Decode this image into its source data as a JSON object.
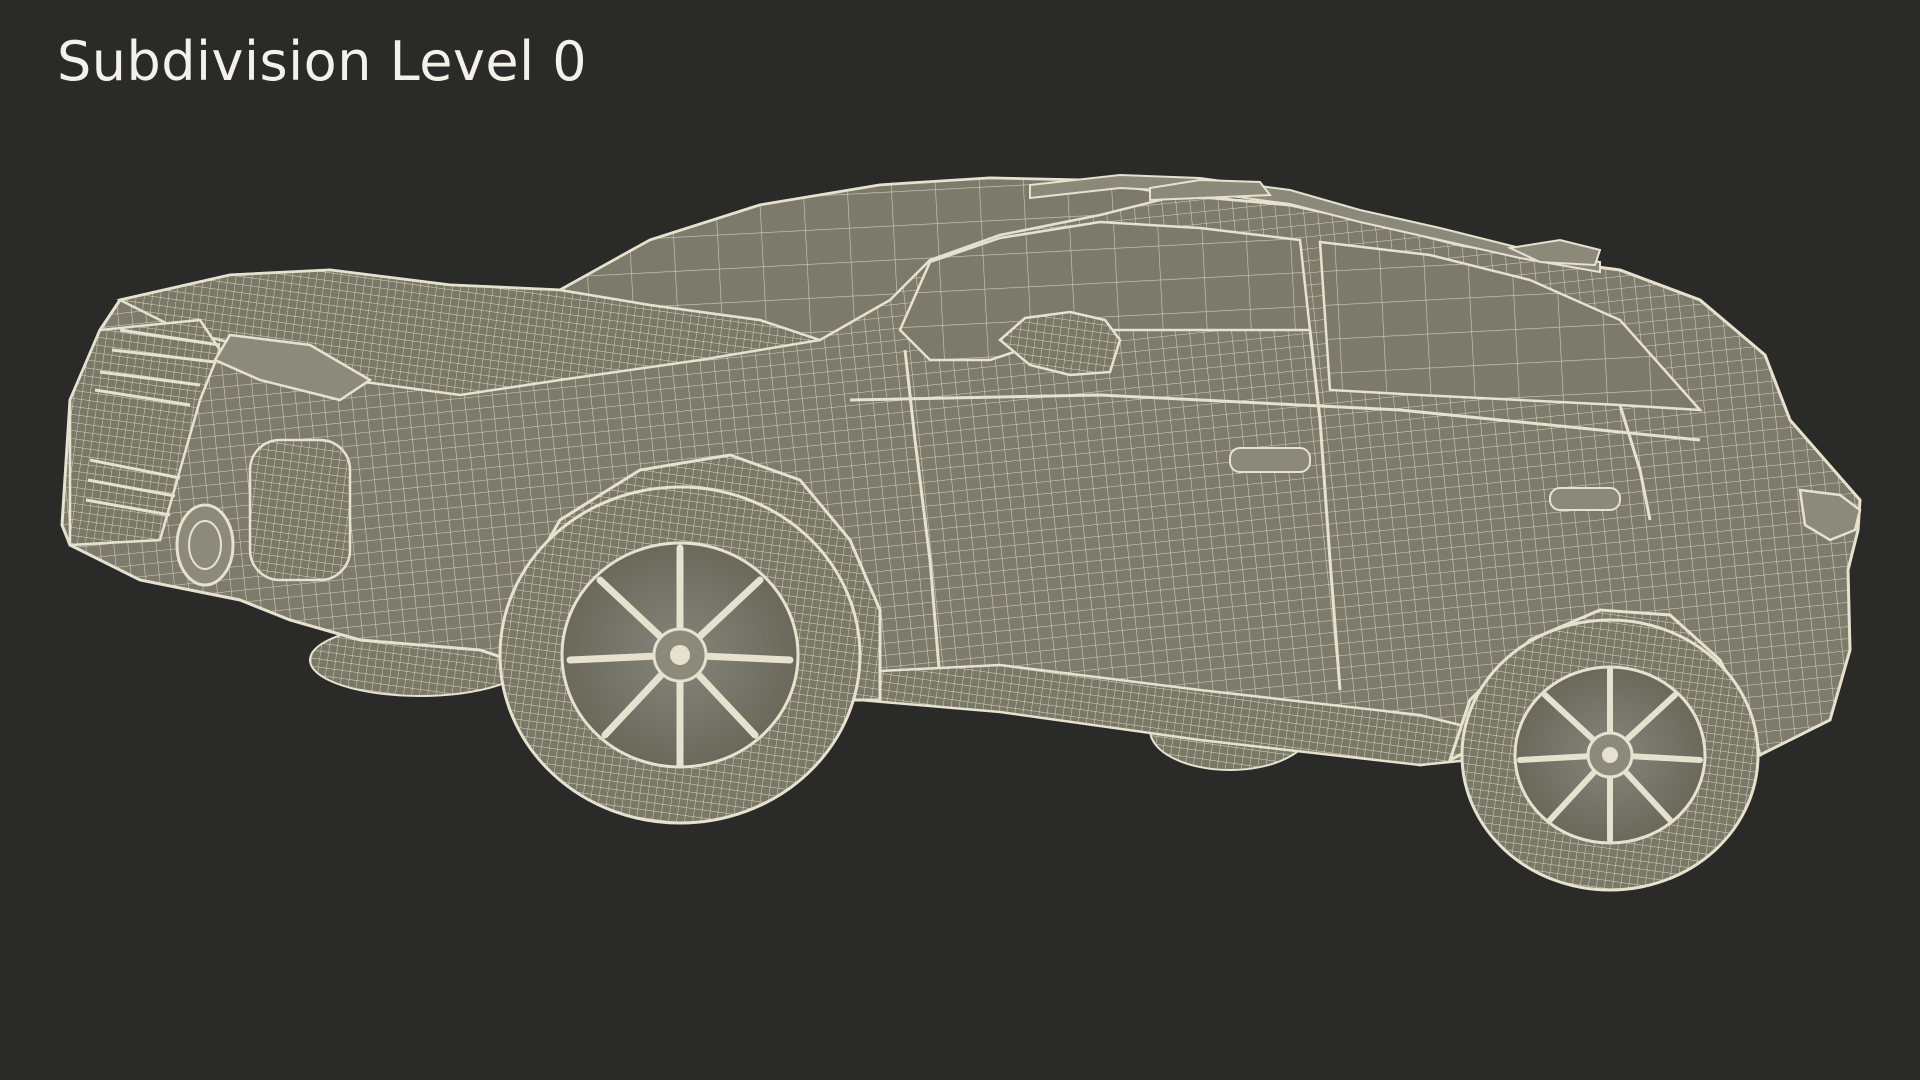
{
  "title": "Subdivision Level 0",
  "colors": {
    "background": "#2a2a28",
    "body_fill": "#7d7c6c",
    "wire": "#e6e2cf",
    "title_text": "#f3f1ea"
  },
  "subject": "car-wireframe-render"
}
